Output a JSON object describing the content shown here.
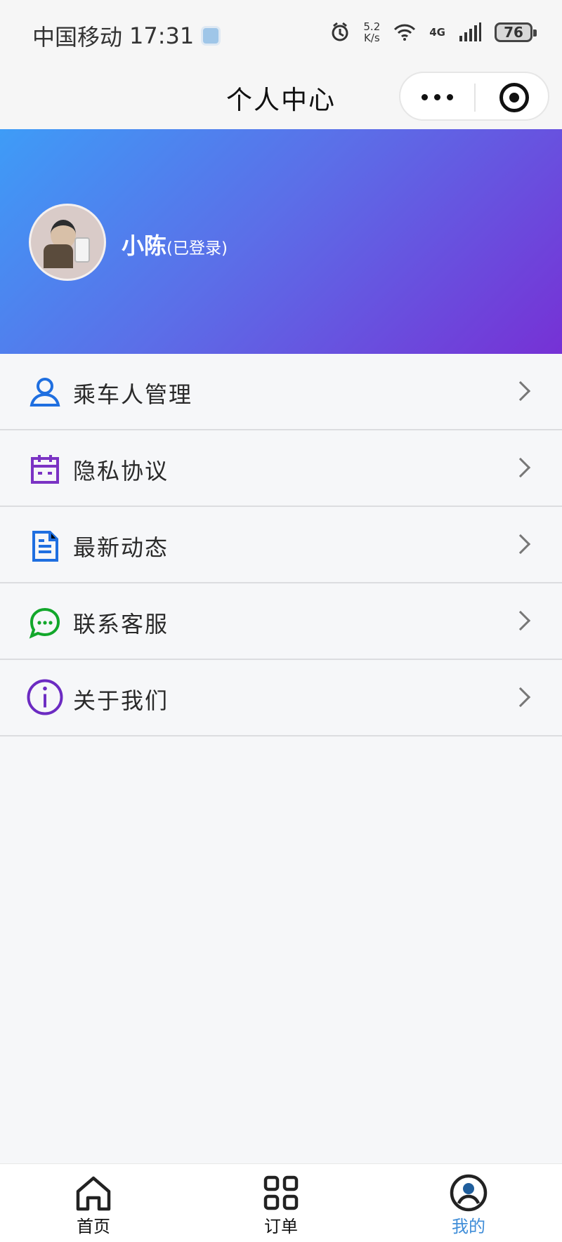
{
  "status_bar": {
    "carrier": "中国移动",
    "time": "17:31",
    "network_speed": "5.2\nK/s",
    "network_type": "4G",
    "battery": "76"
  },
  "nav": {
    "title": "个人中心"
  },
  "profile": {
    "name": "小陈",
    "status": "(已登录)"
  },
  "menu": {
    "items": [
      {
        "label": "乘车人管理",
        "icon": "person-icon",
        "color": "#1f6fe0"
      },
      {
        "label": "隐私协议",
        "icon": "calendar-icon",
        "color": "#7b33c4"
      },
      {
        "label": "最新动态",
        "icon": "document-icon",
        "color": "#1f6fe0"
      },
      {
        "label": "联系客服",
        "icon": "chat-icon",
        "color": "#12a72b"
      },
      {
        "label": "关于我们",
        "icon": "info-icon",
        "color": "#6c2bc2"
      }
    ]
  },
  "tabbar": {
    "items": [
      {
        "label": "首页",
        "icon": "home-icon",
        "active": false
      },
      {
        "label": "订单",
        "icon": "grid-icon",
        "active": false
      },
      {
        "label": "我的",
        "icon": "user-circle-icon",
        "active": true
      }
    ],
    "active_color": "#3f8dd8"
  }
}
